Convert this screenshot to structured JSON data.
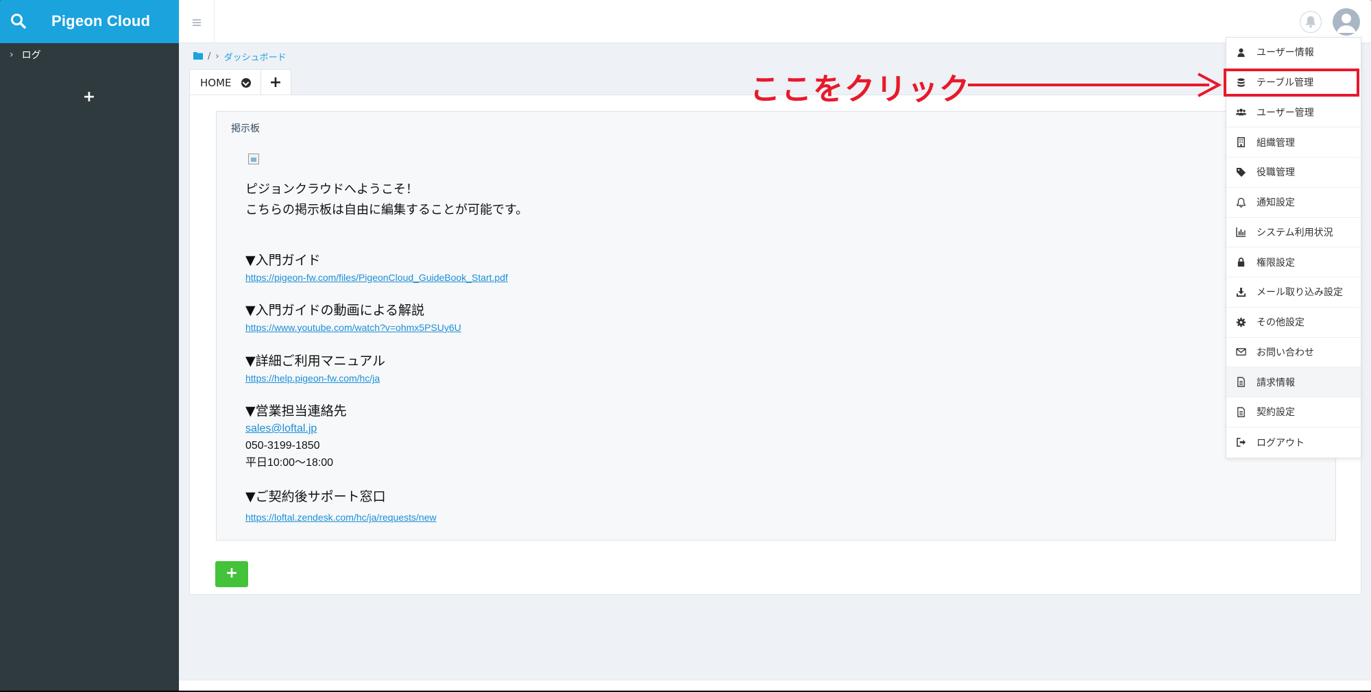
{
  "app": {
    "title": "Pigeon Cloud"
  },
  "sidebar": {
    "items": [
      {
        "label": "ログ"
      }
    ],
    "add_label": "+"
  },
  "breadcrumb": {
    "separator": "/",
    "items": [
      "ダッシュボード"
    ]
  },
  "tabs": [
    {
      "label": "HOME"
    }
  ],
  "tab_add_label": "+",
  "board": {
    "title": "掲示板",
    "welcome": [
      "ピジョンクラウドへようこそ！",
      "こちらの掲示板は自由に編集することが可能です。"
    ],
    "sections": [
      {
        "heading": "▼入門ガイド",
        "links": [
          "https://pigeon-fw.com/files/PigeonCloud_GuideBook_Start.pdf"
        ]
      },
      {
        "heading": "▼入門ガイドの動画による解説",
        "links": [
          "https://www.youtube.com/watch?v=ohmx5PSUy6U"
        ]
      },
      {
        "heading": "▼詳細ご利用マニュアル",
        "links": [
          "https://help.pigeon-fw.com/hc/ja"
        ]
      },
      {
        "heading": "▼営業担当連絡先",
        "links": [
          "sales@loftal.jp"
        ],
        "lines": [
          "050-3199-1850",
          "平日10:00〜18:00"
        ]
      },
      {
        "heading": "▼ご契約後サポート窓口",
        "links": [
          "https://loftal.zendesk.com/hc/ja/requests/new"
        ]
      }
    ]
  },
  "add_block_label": "+",
  "user_menu": {
    "items": [
      {
        "label": "ユーザー情報",
        "icon": "user-icon"
      },
      {
        "label": "テーブル管理",
        "icon": "database-icon"
      },
      {
        "label": "ユーザー管理",
        "icon": "users-icon"
      },
      {
        "label": "組織管理",
        "icon": "building-icon"
      },
      {
        "label": "役職管理",
        "icon": "tag-icon"
      },
      {
        "label": "通知設定",
        "icon": "bell-icon"
      },
      {
        "label": "システム利用状況",
        "icon": "bar-chart-icon"
      },
      {
        "label": "権限設定",
        "icon": "lock-icon"
      },
      {
        "label": "メール取り込み設定",
        "icon": "download-icon"
      },
      {
        "label": "その他設定",
        "icon": "gear-icon"
      },
      {
        "label": "お問い合わせ",
        "icon": "envelope-icon"
      },
      {
        "label": "請求情報",
        "icon": "document-icon"
      },
      {
        "label": "契約設定",
        "icon": "document-icon"
      },
      {
        "label": "ログアウト",
        "icon": "logout-icon"
      }
    ]
  },
  "annotation": {
    "text": "ここをクリック",
    "color": "#e8192c"
  },
  "colors": {
    "brand": "#1aa3dd",
    "sidebar": "#2f3a3e",
    "add_button": "#43c23a",
    "link": "#1a8fd6"
  }
}
